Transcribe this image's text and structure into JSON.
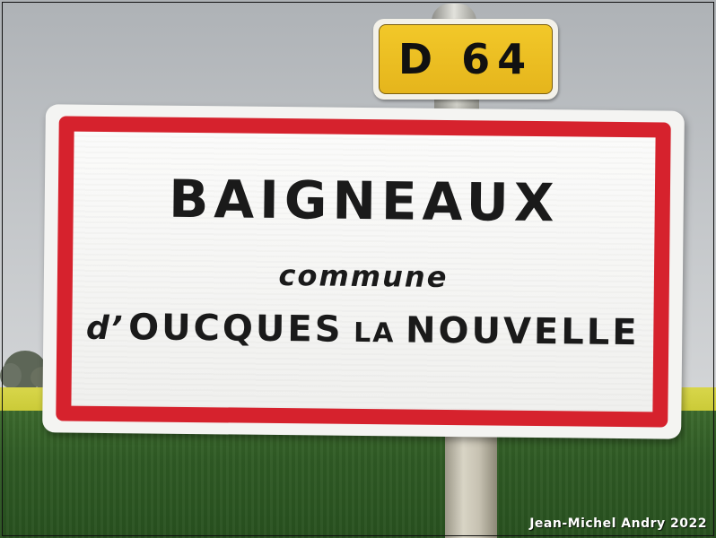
{
  "road_plate": {
    "text": "D 64",
    "color": "#f2c829"
  },
  "town_sign": {
    "name": "BAIGNEAUX",
    "subtitle": "commune",
    "line3_prefix": "d’",
    "line3_main1": "OUCQUES",
    "line3_small": "LA",
    "line3_main2": "NOUVELLE",
    "border_color": "#d6222d"
  },
  "credit": {
    "text": "Jean-Michel Andry 2022"
  }
}
